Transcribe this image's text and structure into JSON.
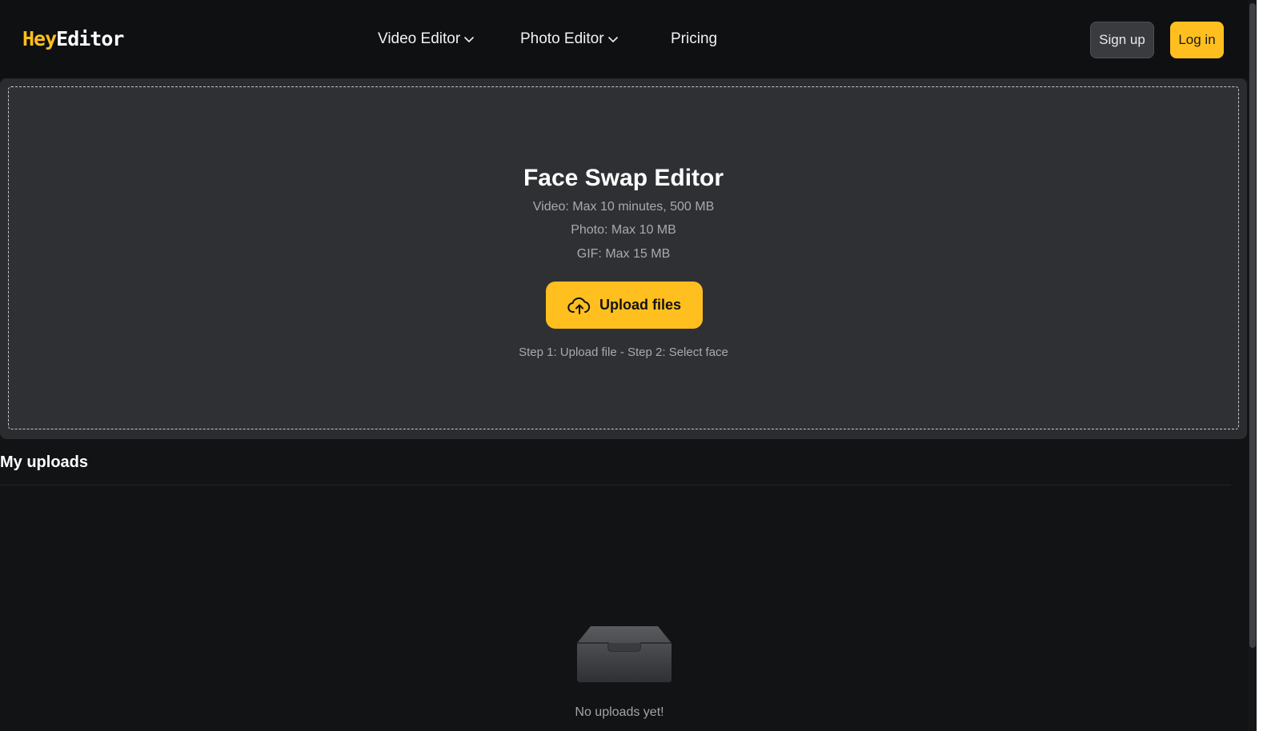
{
  "brand": {
    "logo_part1": "Hey",
    "logo_part2": "Editor",
    "accent_color": "#ffbf1f"
  },
  "nav": {
    "items": [
      {
        "label": "Video Editor",
        "has_dropdown": true
      },
      {
        "label": "Photo Editor",
        "has_dropdown": true
      },
      {
        "label": "Pricing",
        "has_dropdown": false
      }
    ]
  },
  "auth": {
    "signup_label": "Sign up",
    "login_label": "Log in"
  },
  "upload_panel": {
    "title": "Face Swap Editor",
    "limits": [
      "Video: Max 10 minutes, 500 MB",
      "Photo: Max 10 MB",
      "GIF: Max 15 MB"
    ],
    "upload_button_label": "Upload files",
    "upload_icon": "cloud-upload-icon",
    "steps_text": "Step 1: Upload file - Step 2: Select face"
  },
  "uploads": {
    "title": "My uploads",
    "empty_icon": "empty-inbox-icon",
    "empty_text": "No uploads yet!"
  }
}
